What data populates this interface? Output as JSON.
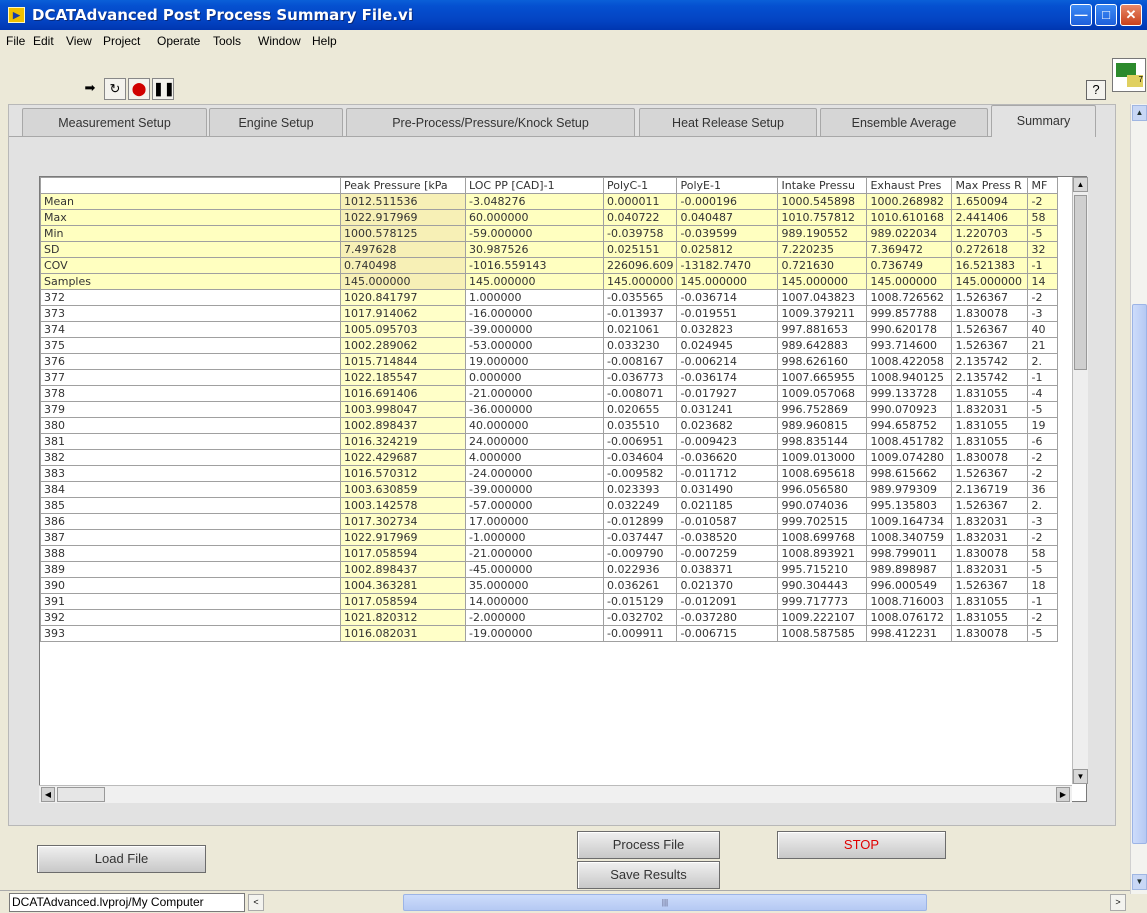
{
  "window": {
    "title": "DCATAdvanced Post Process Summary File.vi"
  },
  "menu": [
    "File",
    "Edit",
    "View",
    "Project",
    "Operate",
    "Tools",
    "Window",
    "Help"
  ],
  "tabs": [
    "Measurement Setup",
    "Engine Setup",
    "Pre-Process/Pressure/Knock Setup",
    "Heat Release Setup",
    "Ensemble Average",
    "Summary"
  ],
  "active_tab": "Summary",
  "table": {
    "columns": [
      "",
      "Peak Pressure [kPa",
      "LOC PP [CAD]-1",
      "PolyC-1",
      "PolyE-1",
      "Intake Pressu",
      "Exhaust Pres",
      "Max Press R",
      "MF"
    ],
    "stat_rows": [
      [
        "Mean",
        "1012.511536",
        "-3.048276",
        "0.000011",
        "-0.000196",
        "1000.545898",
        "1000.268982",
        "1.650094",
        "-2"
      ],
      [
        "Max",
        "1022.917969",
        "60.000000",
        "0.040722",
        "0.040487",
        "1010.757812",
        "1010.610168",
        "2.441406",
        "58"
      ],
      [
        "Min",
        "1000.578125",
        "-59.000000",
        "-0.039758",
        "-0.039599",
        "989.190552",
        "989.022034",
        "1.220703",
        "-5"
      ],
      [
        "SD",
        "7.497628",
        "30.987526",
        "0.025151",
        "0.025812",
        "7.220235",
        "7.369472",
        "0.272618",
        "32"
      ],
      [
        "COV",
        "0.740498",
        "-1016.559143",
        "226096.609",
        "-13182.7470",
        "0.721630",
        "0.736749",
        "16.521383",
        "-1"
      ],
      [
        "Samples",
        "145.000000",
        "145.000000",
        "145.000000",
        "145.000000",
        "145.000000",
        "145.000000",
        "145.000000",
        "14"
      ]
    ],
    "rows": [
      [
        "372",
        "1020.841797",
        "1.000000",
        "-0.035565",
        "-0.036714",
        "1007.043823",
        "1008.726562",
        "1.526367",
        "-2"
      ],
      [
        "373",
        "1017.914062",
        "-16.000000",
        "-0.013937",
        "-0.019551",
        "1009.379211",
        "999.857788",
        "1.830078",
        "-3"
      ],
      [
        "374",
        "1005.095703",
        "-39.000000",
        "0.021061",
        "0.032823",
        "997.881653",
        "990.620178",
        "1.526367",
        "40"
      ],
      [
        "375",
        "1002.289062",
        "-53.000000",
        "0.033230",
        "0.024945",
        "989.642883",
        "993.714600",
        "1.526367",
        "21"
      ],
      [
        "376",
        "1015.714844",
        "19.000000",
        "-0.008167",
        "-0.006214",
        "998.626160",
        "1008.422058",
        "2.135742",
        "2."
      ],
      [
        "377",
        "1022.185547",
        "0.000000",
        "-0.036773",
        "-0.036174",
        "1007.665955",
        "1008.940125",
        "2.135742",
        "-1"
      ],
      [
        "378",
        "1016.691406",
        "-21.000000",
        "-0.008071",
        "-0.017927",
        "1009.057068",
        "999.133728",
        "1.831055",
        "-4"
      ],
      [
        "379",
        "1003.998047",
        "-36.000000",
        "0.020655",
        "0.031241",
        "996.752869",
        "990.070923",
        "1.832031",
        "-5"
      ],
      [
        "380",
        "1002.898437",
        "40.000000",
        "0.035510",
        "0.023682",
        "989.960815",
        "994.658752",
        "1.831055",
        "19"
      ],
      [
        "381",
        "1016.324219",
        "24.000000",
        "-0.006951",
        "-0.009423",
        "998.835144",
        "1008.451782",
        "1.831055",
        "-6"
      ],
      [
        "382",
        "1022.429687",
        "4.000000",
        "-0.034604",
        "-0.036620",
        "1009.013000",
        "1009.074280",
        "1.830078",
        "-2"
      ],
      [
        "383",
        "1016.570312",
        "-24.000000",
        "-0.009582",
        "-0.011712",
        "1008.695618",
        "998.615662",
        "1.526367",
        "-2"
      ],
      [
        "384",
        "1003.630859",
        "-39.000000",
        "0.023393",
        "0.031490",
        "996.056580",
        "989.979309",
        "2.136719",
        "36"
      ],
      [
        "385",
        "1003.142578",
        "-57.000000",
        "0.032249",
        "0.021185",
        "990.074036",
        "995.135803",
        "1.526367",
        "2."
      ],
      [
        "386",
        "1017.302734",
        "17.000000",
        "-0.012899",
        "-0.010587",
        "999.702515",
        "1009.164734",
        "1.832031",
        "-3"
      ],
      [
        "387",
        "1022.917969",
        "-1.000000",
        "-0.037447",
        "-0.038520",
        "1008.699768",
        "1008.340759",
        "1.832031",
        "-2"
      ],
      [
        "388",
        "1017.058594",
        "-21.000000",
        "-0.009790",
        "-0.007259",
        "1008.893921",
        "998.799011",
        "1.830078",
        "58"
      ],
      [
        "389",
        "1002.898437",
        "-45.000000",
        "0.022936",
        "0.038371",
        "995.715210",
        "989.898987",
        "1.832031",
        "-5"
      ],
      [
        "390",
        "1004.363281",
        "35.000000",
        "0.036261",
        "0.021370",
        "990.304443",
        "996.000549",
        "1.526367",
        "18"
      ],
      [
        "391",
        "1017.058594",
        "14.000000",
        "-0.015129",
        "-0.012091",
        "999.717773",
        "1008.716003",
        "1.831055",
        "-1"
      ],
      [
        "392",
        "1021.820312",
        "-2.000000",
        "-0.032702",
        "-0.037280",
        "1009.222107",
        "1008.076172",
        "1.831055",
        "-2"
      ],
      [
        "393",
        "1016.082031",
        "-19.000000",
        "-0.009911",
        "-0.006715",
        "1008.587585",
        "998.412231",
        "1.830078",
        "-5"
      ]
    ]
  },
  "buttons": {
    "load": "Load File",
    "process": "Process File",
    "save": "Save Results",
    "stop": "STOP"
  },
  "status": {
    "path": "DCATAdvanced.lvproj/My Computer"
  },
  "toolbar": {
    "help_glyph": "?"
  },
  "colors": {
    "titlebar": "#0550d0",
    "highlight_cells": "#ffffc0",
    "stop_text": "#e00000"
  }
}
